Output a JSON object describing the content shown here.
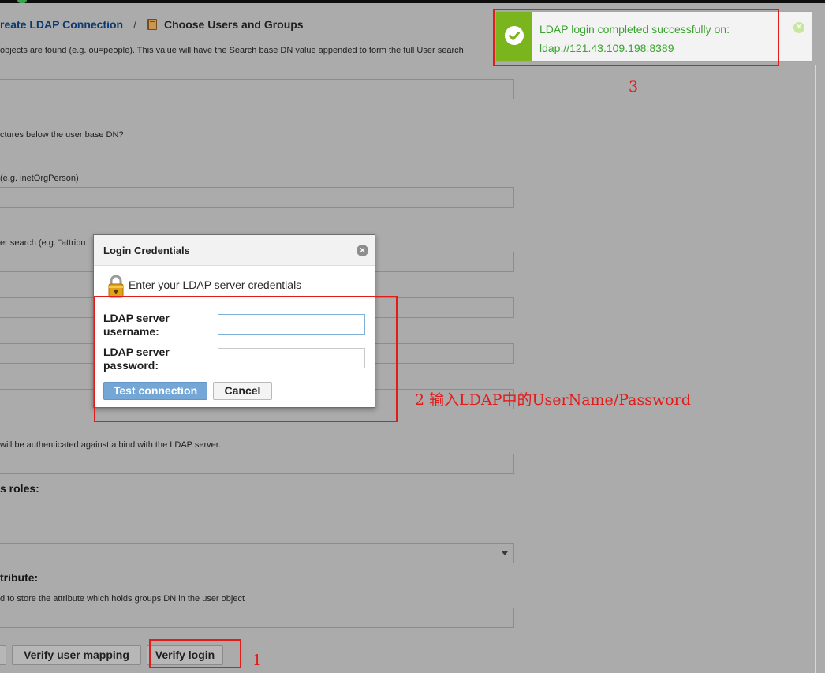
{
  "breadcrumb": {
    "parent": "reate LDAP Connection",
    "separator": "/",
    "current": "Choose Users and Groups"
  },
  "form": {
    "hint_user_object": "objects are found (e.g. ou=people). This value will have the Search base DN value appended to form the full User search",
    "hint_subtree": "ctures below the user base DN?",
    "hint_object_class": "(e.g. inetOrgPerson)",
    "hint_search_filter": "er search (e.g. \"attribu",
    "hint_bind": "will be authenticated against a bind with the LDAP server.",
    "roles_label": "s roles:",
    "attribute_label": "tribute:",
    "hint_groups": "d to store the attribute which holds groups DN in the user object"
  },
  "buttons": {
    "verify_user_mapping": "Verify user mapping",
    "verify_login": "Verify login"
  },
  "dialog": {
    "title": "Login Credentials",
    "subtitle": "Enter your LDAP server credentials",
    "username_label": "LDAP server username:",
    "password_label": "LDAP server password:",
    "username_value": "",
    "password_value": "",
    "test_button": "Test connection",
    "cancel_button": "Cancel"
  },
  "toast": {
    "line1": "LDAP login completed successfully on:",
    "line2": "ldap://121.43.109.198:8389"
  },
  "annotations": {
    "step1": "1",
    "step2": "2 输入LDAP中的UserName/Password",
    "step3": "3"
  },
  "colors": {
    "overlay_bg": "#ababab",
    "toast_accent": "#7ab51d",
    "primary_button": "#74a7d6",
    "annotation_red": "#e21b1b"
  }
}
